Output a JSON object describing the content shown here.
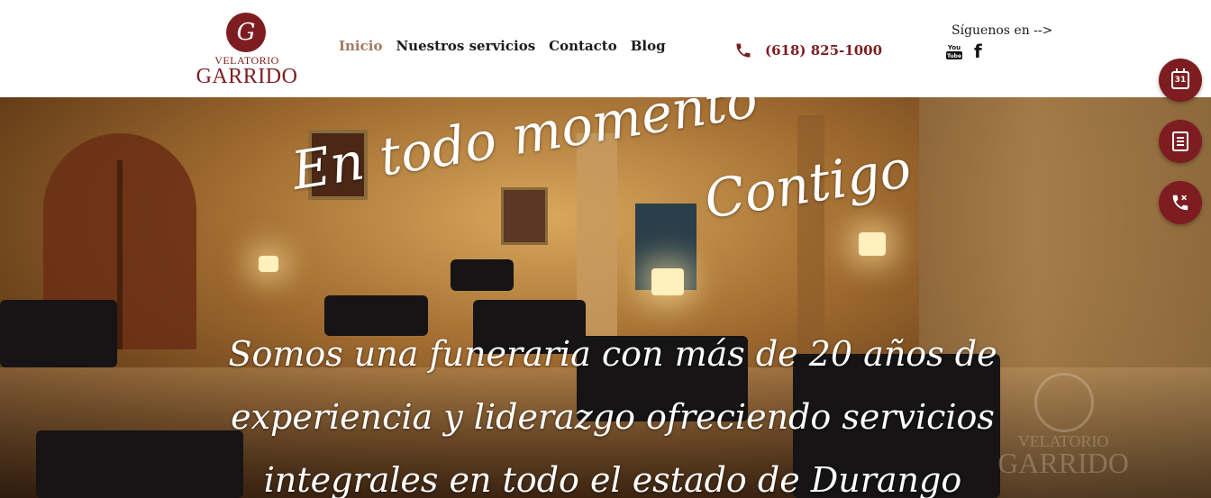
{
  "brand": {
    "logo_mark": "G",
    "logo_small": "VELATORIO",
    "logo_big": "GARRIDO"
  },
  "nav": {
    "items": [
      {
        "label": "Inicio",
        "active": true
      },
      {
        "label": "Nuestros servicios",
        "active": false
      },
      {
        "label": "Contacto",
        "active": false
      },
      {
        "label": "Blog",
        "active": false
      }
    ]
  },
  "contact": {
    "phone": "(618) 825-1000",
    "phone_icon": "phone-icon"
  },
  "social": {
    "label": "Síguenos en -->",
    "youtube_icon": "youtube-icon",
    "facebook_glyph": "f"
  },
  "hero": {
    "headline_line1": "En todo momento",
    "headline_line2": "Contigo",
    "tagline_lines": [
      "Somos una funeraria con más de 20 años de",
      "experiencia y liderazgo ofreciendo servicios",
      "integrales en todo el estado de Durango"
    ],
    "watermark_small": "VELATORIO",
    "watermark_big": "GARRIDO"
  },
  "side_buttons": {
    "calendar_day": "31",
    "icons": [
      "calendar-icon",
      "document-icon",
      "phone-call-icon"
    ]
  },
  "colors": {
    "brand": "#7d1d21",
    "nav_active": "#a07b62",
    "text": "#1b1b1b"
  }
}
